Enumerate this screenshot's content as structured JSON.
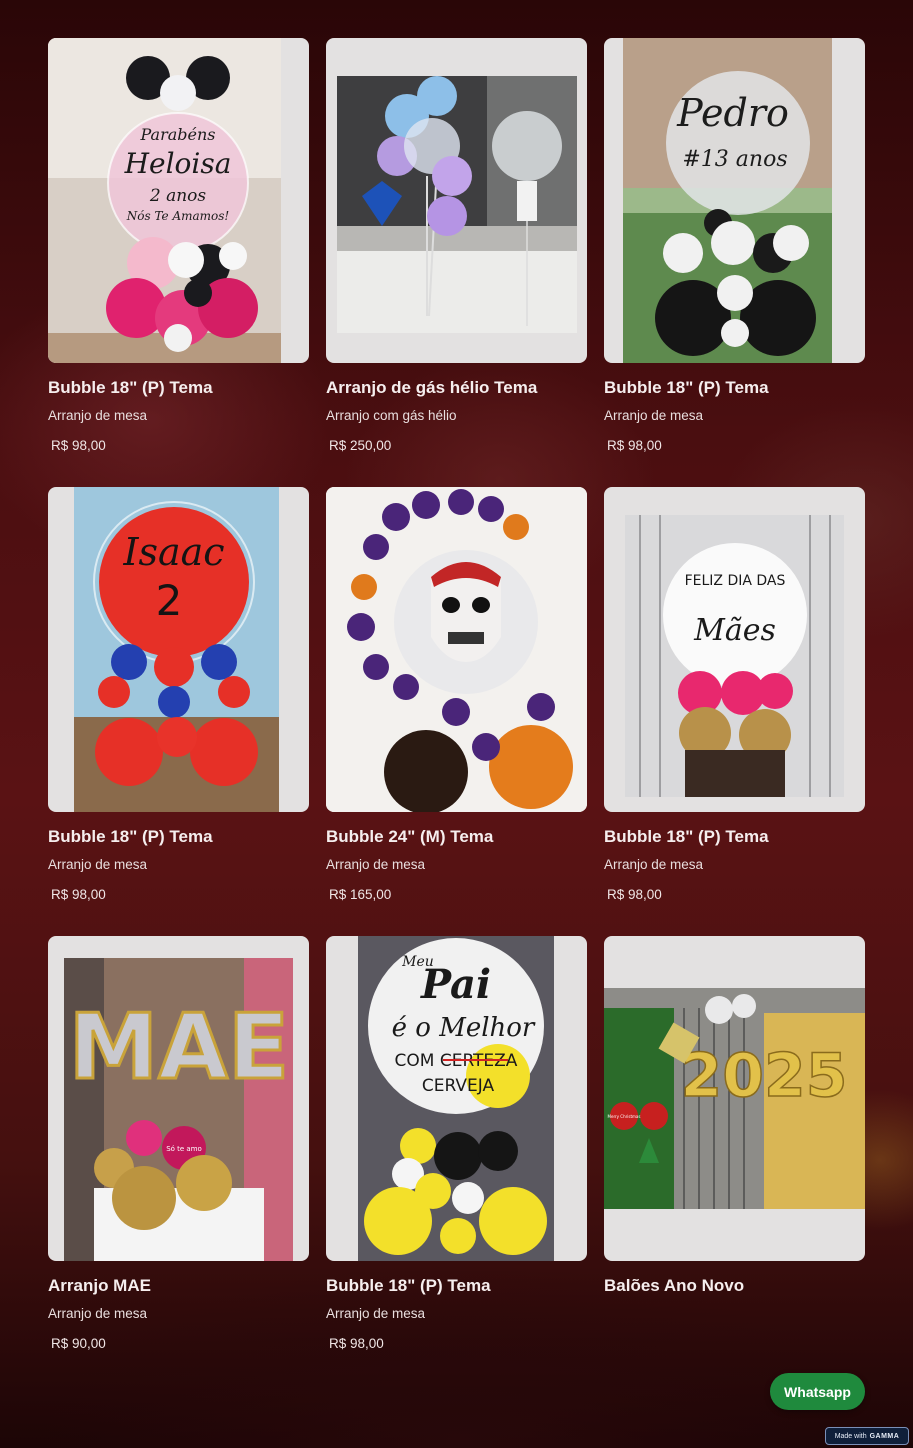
{
  "products": [
    {
      "title": "Bubble 18\" (P) Tema",
      "subtitle": "Arranjo de mesa",
      "price": "R$ 98,00",
      "image": "balloon-heloisa-minnie",
      "balloon_text": [
        "Parabéns",
        "Heloisa",
        "2 anos",
        "Nós Te Amamos!"
      ]
    },
    {
      "title": "Arranjo de gás hélio Tema",
      "subtitle": "Arranjo com gás hélio",
      "price": "R$ 250,00",
      "image": "balloon-helium-bouquet",
      "balloon_text": []
    },
    {
      "title": "Bubble 18\" (P) Tema",
      "subtitle": "Arranjo de mesa",
      "price": "R$ 98,00",
      "image": "balloon-pedro-corinthians",
      "balloon_text": [
        "Pedro",
        "#13 anos"
      ]
    },
    {
      "title": "Bubble 18\" (P) Tema",
      "subtitle": "Arranjo de mesa",
      "price": "R$ 98,00",
      "image": "balloon-isaac-spiderman",
      "balloon_text": [
        "Isaac",
        "2"
      ]
    },
    {
      "title": "Bubble 24\" (M) Tema",
      "subtitle": "Arranjo de mesa",
      "price": "R$ 165,00",
      "image": "balloon-halloween-skull",
      "balloon_text": []
    },
    {
      "title": "Bubble 18\" (P) Tema",
      "subtitle": "Arranjo de mesa",
      "price": "R$ 98,00",
      "image": "balloon-dia-das-maes",
      "balloon_text": [
        "FELIZ DIA DAS",
        "Mães"
      ]
    },
    {
      "title": "Arranjo MAE",
      "subtitle": "Arranjo de mesa",
      "price": "R$ 90,00",
      "image": "balloon-mae-letters",
      "balloon_text": [
        "MAE",
        "Só te amo"
      ]
    },
    {
      "title": "Bubble 18\" (P) Tema",
      "subtitle": "Arranjo de mesa",
      "price": "R$ 98,00",
      "image": "balloon-meu-pai",
      "balloon_text": [
        "Meu",
        "Pai",
        "é o Melhor",
        "COM CERTEZA",
        "CERVEJA"
      ]
    },
    {
      "title": "Balões Ano Novo",
      "subtitle": "",
      "price": "",
      "image": "balloon-ano-novo-2025",
      "balloon_text": [
        "2025",
        "Merry Christmas"
      ]
    }
  ],
  "whatsapp_button": {
    "label": "Whatsapp",
    "color": "#1f8a3d"
  },
  "gamma_badge": {
    "prefix": "Made with",
    "brand": "GAMMA"
  },
  "colors": {
    "card_bg": "#e3e1e1",
    "page_bg": "#4a0e10",
    "text": "#f6eeee"
  }
}
